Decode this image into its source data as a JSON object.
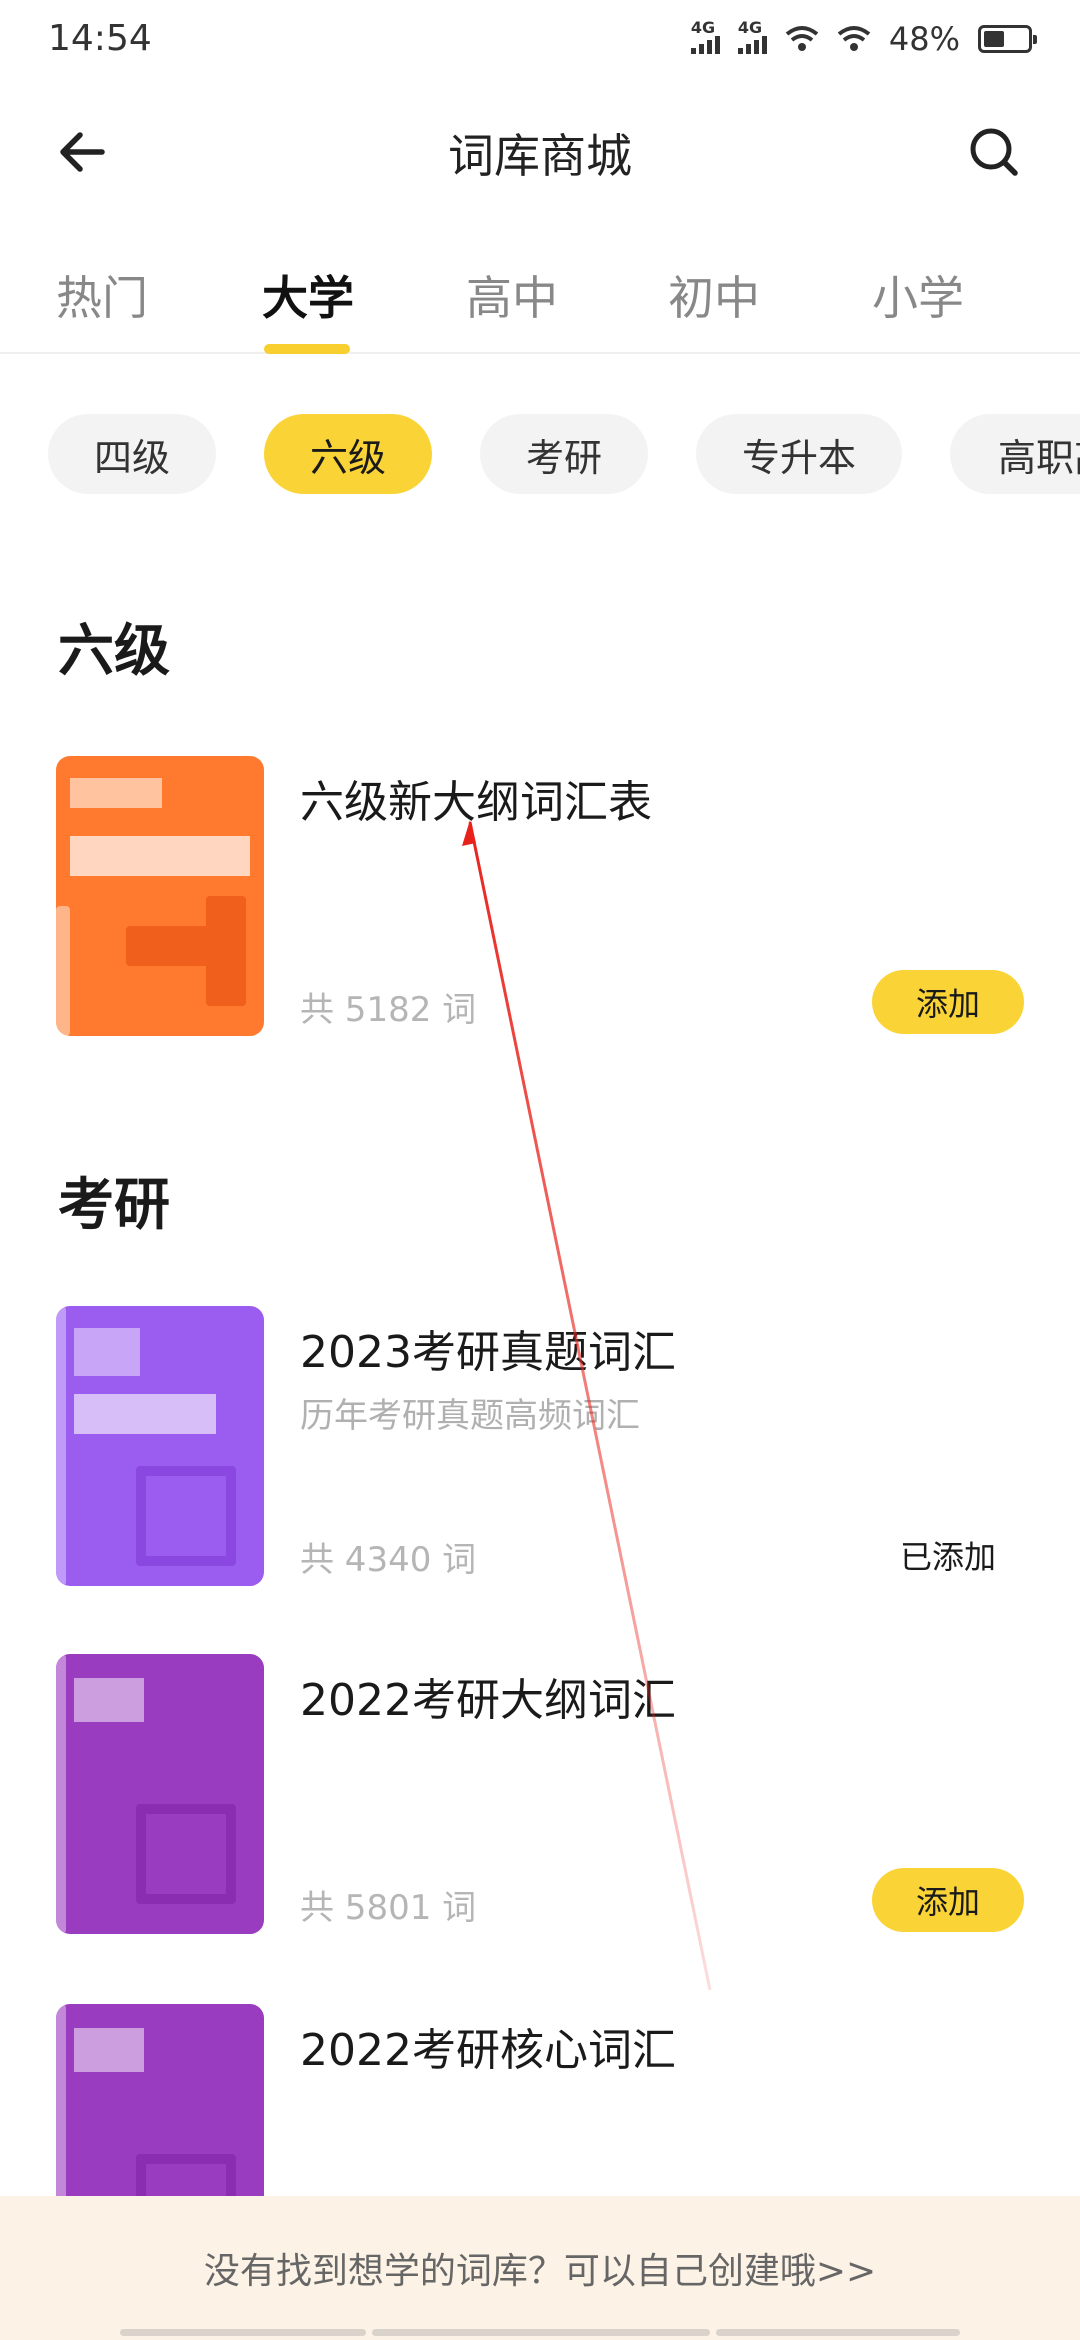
{
  "status_bar": {
    "time": "14:54",
    "battery": "48%",
    "battery_level": 0.48,
    "signal_label": "4G"
  },
  "header": {
    "title": "词库商城",
    "back_icon": "back-arrow-icon",
    "search_icon": "search-icon"
  },
  "tabs": [
    {
      "label": "热门",
      "active": false
    },
    {
      "label": "大学",
      "active": true
    },
    {
      "label": "高中",
      "active": false
    },
    {
      "label": "初中",
      "active": false
    },
    {
      "label": "小学",
      "active": false
    }
  ],
  "chips": [
    {
      "label": "四级",
      "active": false
    },
    {
      "label": "六级",
      "active": true
    },
    {
      "label": "考研",
      "active": false
    },
    {
      "label": "专升本",
      "active": false
    },
    {
      "label": "高职高专",
      "active": false
    }
  ],
  "sections": [
    {
      "title": "六级",
      "books": [
        {
          "title": "六级新大纲词汇表",
          "subtitle": "",
          "count": "共 5182 词",
          "action": "添加",
          "added": false,
          "cover_color": "#ff7a2e"
        }
      ]
    },
    {
      "title": "考研",
      "books": [
        {
          "title": "2023考研真题词汇",
          "subtitle": "历年考研真题高频词汇",
          "count": "共 4340 词",
          "action": "已添加",
          "added": true,
          "cover_color": "#9b5cf0"
        },
        {
          "title": "2022考研大纲词汇",
          "subtitle": "",
          "count": "共 5801 词",
          "action": "添加",
          "added": false,
          "cover_color": "#9a3cbf"
        },
        {
          "title": "2022考研核心词汇",
          "subtitle": "",
          "count": "",
          "action": "",
          "added": false,
          "cover_color": "#9a3cbf"
        }
      ]
    }
  ],
  "bottom_banner": {
    "text": "没有找到想学的词库？可以自己创建哦>>"
  },
  "colors": {
    "accent": "#fad436",
    "annotation_arrow": "#e8221b"
  }
}
